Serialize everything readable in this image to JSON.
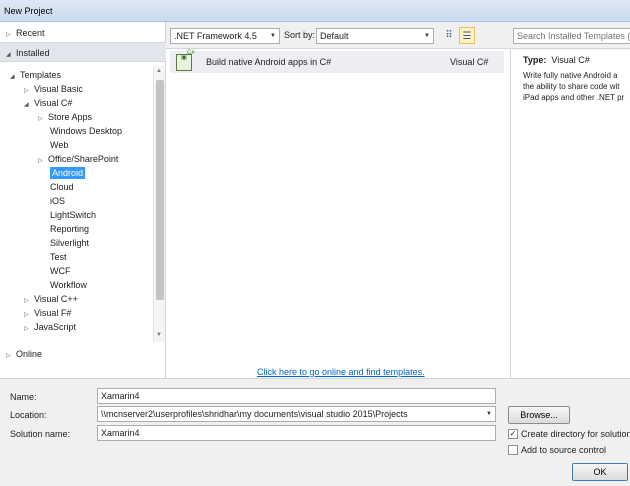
{
  "window": {
    "title": "New Project"
  },
  "nav": {
    "recent": "Recent",
    "installed": "Installed",
    "online": "Online",
    "tree": [
      {
        "label": "Templates",
        "indent": 0,
        "arrow": "◢"
      },
      {
        "label": "Visual Basic",
        "indent": 1,
        "arrow": "▷"
      },
      {
        "label": "Visual C#",
        "indent": 1,
        "arrow": "◢"
      },
      {
        "label": "Store Apps",
        "indent": 2,
        "arrow": "▷"
      },
      {
        "label": "Windows Desktop",
        "indent": 3,
        "arrow": ""
      },
      {
        "label": "Web",
        "indent": 3,
        "arrow": ""
      },
      {
        "label": "Office/SharePoint",
        "indent": 2,
        "arrow": "▷"
      },
      {
        "label": "Android",
        "indent": 3,
        "arrow": "",
        "selected": true
      },
      {
        "label": "Cloud",
        "indent": 3,
        "arrow": ""
      },
      {
        "label": "iOS",
        "indent": 3,
        "arrow": ""
      },
      {
        "label": "LightSwitch",
        "indent": 3,
        "arrow": ""
      },
      {
        "label": "Reporting",
        "indent": 3,
        "arrow": ""
      },
      {
        "label": "Silverlight",
        "indent": 3,
        "arrow": ""
      },
      {
        "label": "Test",
        "indent": 3,
        "arrow": ""
      },
      {
        "label": "WCF",
        "indent": 3,
        "arrow": ""
      },
      {
        "label": "Workflow",
        "indent": 3,
        "arrow": ""
      },
      {
        "label": "Visual C++",
        "indent": 1,
        "arrow": "▷"
      },
      {
        "label": "Visual F#",
        "indent": 1,
        "arrow": "▷"
      },
      {
        "label": "JavaScript",
        "indent": 1,
        "arrow": "▷"
      }
    ]
  },
  "toolbar": {
    "framework": ".NET Framework 4.5",
    "sort_label": "Sort by:",
    "sort_value": "Default",
    "search_placeholder": "Search Installed Templates (C"
  },
  "templates": {
    "items": [
      {
        "name": "Build native Android apps in C#",
        "language": "Visual C#",
        "icon": "android-project-icon"
      }
    ],
    "online_link": "Click here to go online and find templates."
  },
  "info": {
    "type_label": "Type:",
    "type_value": "Visual C#",
    "description_lines": [
      "Write fully native Android a",
      "the ability to share code wit",
      "iPad apps and other .NET pr"
    ]
  },
  "form": {
    "name_label": "Name:",
    "name_value": "Xamarin4",
    "location_label": "Location:",
    "location_value": "\\\\mcnserver2\\userprofiles\\shridhar\\my documents\\visual studio 2015\\Projects",
    "solution_label": "Solution name:",
    "solution_value": "Xamarin4",
    "browse": "Browse...",
    "create_dir": "Create directory for solution",
    "create_dir_checked": true,
    "add_source": "Add to source control",
    "add_source_checked": false,
    "ok": "OK"
  }
}
